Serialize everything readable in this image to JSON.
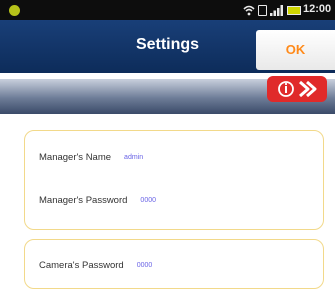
{
  "status_bar": {
    "time": "12:00",
    "icons": [
      "app-logo-icon",
      "wifi-icon",
      "sim-card-icon",
      "signal-icon",
      "battery-icon"
    ],
    "accent_colors": {
      "logo": "#b6c21a",
      "battery": "#cfd600"
    }
  },
  "header": {
    "title": "Settings",
    "ok_label": "OK",
    "background": "#0d2c5a",
    "ok_color": "#ff8a1a"
  },
  "info_badge": {
    "icon": "info-icon",
    "color": "#e02a2a"
  },
  "manager_card": {
    "fields": [
      {
        "label": "Manager's Name",
        "value": "admin"
      },
      {
        "label": "Manager's Password",
        "value": "0000"
      }
    ]
  },
  "camera_card": {
    "fields": [
      {
        "label": "Camera's Password",
        "value": "0000"
      }
    ]
  }
}
